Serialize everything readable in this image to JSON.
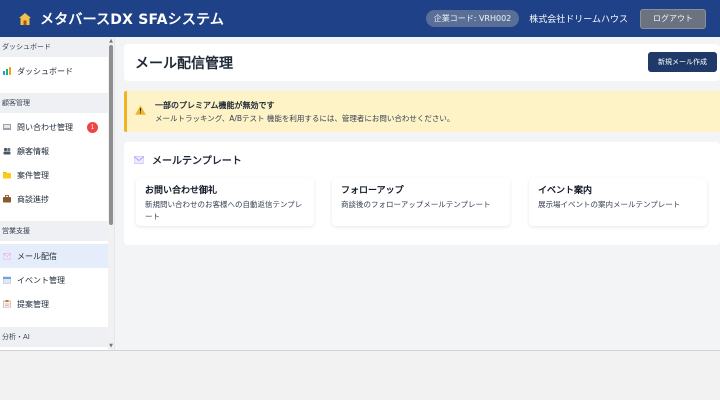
{
  "header": {
    "app_title": "メタバースDX SFAシステム",
    "company_code": "企業コード: VRH002",
    "company_name": "株式会社ドリームハウス",
    "logout_label": "ログアウト"
  },
  "sidebar": {
    "sections": [
      {
        "label": "ダッシュボード"
      },
      {
        "label": "顧客管理"
      },
      {
        "label": "営業支援"
      },
      {
        "label": "分析・AI"
      }
    ],
    "items": [
      {
        "label": "ダッシュボード",
        "icon": "bar-chart-icon"
      },
      {
        "label": "問い合わせ管理",
        "icon": "inbox-icon",
        "badge": "1"
      },
      {
        "label": "顧客情報",
        "icon": "users-icon"
      },
      {
        "label": "案件管理",
        "icon": "folder-icon"
      },
      {
        "label": "商談進捗",
        "icon": "briefcase-icon"
      },
      {
        "label": "メール配信",
        "icon": "envelope-icon",
        "active": true
      },
      {
        "label": "イベント管理",
        "icon": "calendar-icon"
      },
      {
        "label": "提案管理",
        "icon": "clipboard-icon"
      }
    ]
  },
  "main": {
    "page_title": "メール配信管理",
    "new_mail_button": "新規メール作成",
    "warning": {
      "title": "一部のプレミアム機能が無効です",
      "message": "メールトラッキング、A/Bテスト 機能を利用するには、管理者にお問い合わせください。"
    },
    "templates": {
      "heading": "メールテンプレート",
      "cards": [
        {
          "title": "お問い合わせ御礼",
          "description": "新規問い合わせのお客様への自動返信テンプレート"
        },
        {
          "title": "フォローアップ",
          "description": "商談後のフォローアップメールテンプレート"
        },
        {
          "title": "イベント案内",
          "description": "展示場イベントの案内メールテンプレート"
        }
      ]
    }
  },
  "colors": {
    "topbar": "#1f4187",
    "primary_button": "#1f3a68",
    "warning_bg": "#fdf3c7",
    "warning_accent": "#f0b429",
    "badge": "#ef4444",
    "active_nav": "#e4edf9"
  }
}
